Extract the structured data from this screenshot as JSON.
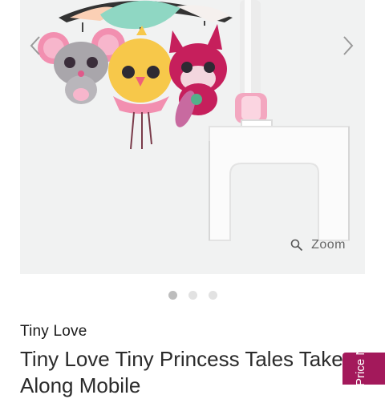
{
  "product": {
    "brand": "Tiny Love",
    "title": "Tiny Love Tiny Princess Tales Take Along Mobile"
  },
  "gallery": {
    "zoom_label": "Zoom",
    "slides": 3,
    "active_slide": 1,
    "prev_icon": "chevron-left-icon",
    "next_icon": "chevron-right-icon",
    "zoom_icon": "magnifier-icon"
  },
  "side_tab": {
    "label": "Price Notice",
    "color": "#a3195b"
  }
}
